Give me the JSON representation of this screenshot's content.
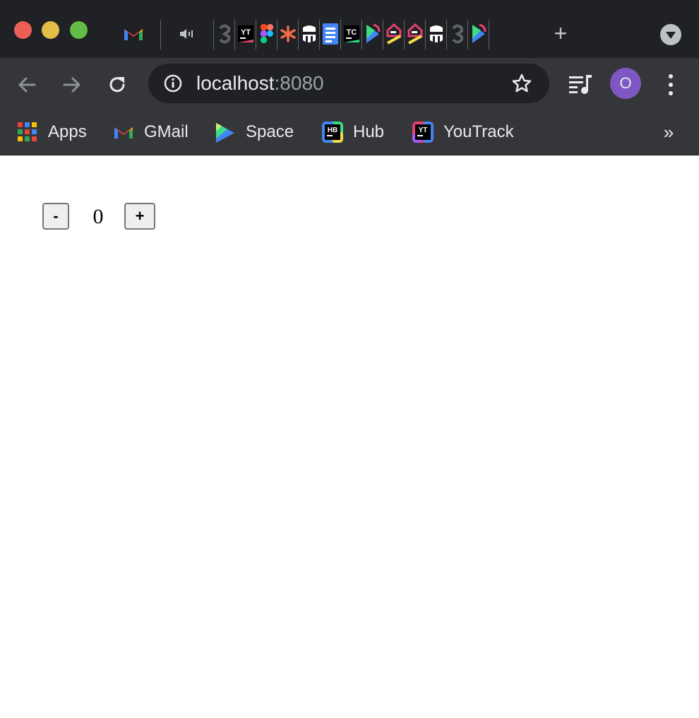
{
  "browser": {
    "address": {
      "host": "localhost",
      "port": ":8080"
    },
    "profile_initial": "O",
    "bookmarks": [
      {
        "label": "Apps",
        "icon": "apps-grid-icon"
      },
      {
        "label": "GMail",
        "icon": "gmail-icon"
      },
      {
        "label": "Space",
        "icon": "space-icon"
      },
      {
        "label": "Hub",
        "icon": "hub-icon",
        "badge": "HB"
      },
      {
        "label": "YouTrack",
        "icon": "youtrack-icon",
        "badge": "YT"
      }
    ],
    "bookmarks_overflow": "»",
    "new_tab": "+",
    "tab_badges": {
      "youtrack": "YT",
      "teamcity": "TC"
    },
    "colors": {
      "tabstrip": "#202124",
      "toolbar": "#35363a",
      "avatar": "#7e57c2"
    }
  },
  "page": {
    "minus_label": "-",
    "count": "0",
    "plus_label": "+"
  }
}
